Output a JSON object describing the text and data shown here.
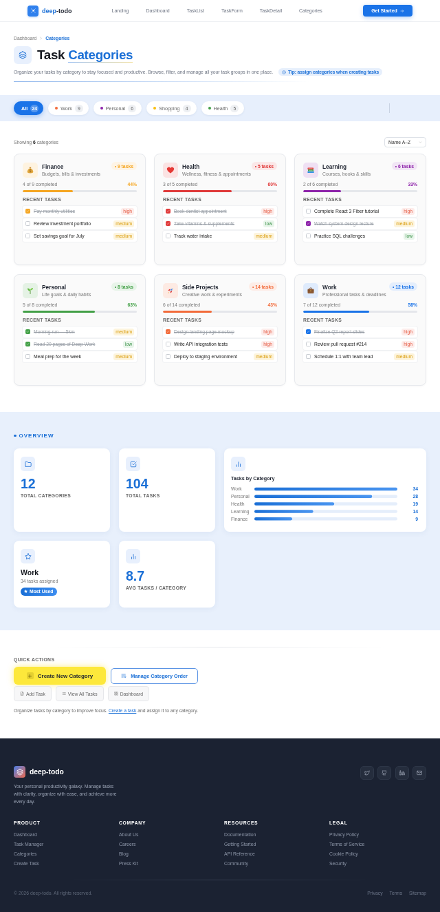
{
  "nav": {
    "brand": {
      "accent": "deep",
      "rest": "-todo"
    },
    "links": [
      "Landing",
      "Dashboard",
      "TaskList",
      "TaskForm",
      "TaskDetail",
      "Categories"
    ],
    "cta": "Get Started"
  },
  "breadcrumb": [
    {
      "label": "Dashboard",
      "current": false
    },
    {
      "label": "Categories",
      "current": true
    }
  ],
  "hero": {
    "title": "Task",
    "title_accent": "Categories",
    "description": "Organize your tasks by category to stay focused and productive. Browse, filter, and manage all your task groups in one place.",
    "tip": "Tip: assign categories when creating tasks"
  },
  "filters": [
    {
      "label": "All",
      "count": "24",
      "selected": true
    },
    {
      "label": "Work",
      "count": "9",
      "selected": false,
      "color": "#f26b3a"
    },
    {
      "label": "Personal",
      "count": "6",
      "selected": false,
      "color": "#8e24aa"
    },
    {
      "label": "Shopping",
      "count": "4",
      "selected": false,
      "color": "#f9bf0f"
    },
    {
      "label": "Health",
      "count": "5",
      "selected": false,
      "color": "#43a047"
    }
  ],
  "listing": {
    "summary": "Showing **6** categories",
    "sort": "Name A–Z"
  },
  "categories": [
    {
      "name": "Finance",
      "description": "Budgets, bills & investments",
      "color": "#f5a623",
      "badge": "• 9 tasks",
      "progress": "4 of 9 completed",
      "percent": "44%",
      "level": 0.44,
      "section_label": "RECENT TASKS",
      "tasks": [
        {
          "title": "Pay monthly utilities",
          "done": true,
          "priority": "high",
          "kind": "high"
        },
        {
          "title": "Review investment portfolio",
          "done": false,
          "priority": "medium",
          "kind": "medium"
        },
        {
          "title": "Set savings goal for July",
          "done": false,
          "priority": "medium",
          "kind": "medium"
        }
      ]
    },
    {
      "name": "Health",
      "description": "Wellness, fitness & appointments",
      "color": "#e03a3a",
      "badge": "• 5 tasks",
      "progress": "3 of 5 completed",
      "percent": "60%",
      "level": 0.6,
      "section_label": "RECENT TASKS",
      "tasks": [
        {
          "title": "Book dentist appointment",
          "done": true,
          "priority": "high",
          "kind": "high"
        },
        {
          "title": "Take vitamins & supplements",
          "done": true,
          "priority": "low",
          "kind": "low"
        },
        {
          "title": "Track water intake",
          "done": false,
          "priority": "medium",
          "kind": "medium"
        }
      ]
    },
    {
      "name": "Learning",
      "description": "Courses, books & skills",
      "color": "#8e24aa",
      "badge": "• 6 tasks",
      "progress": "2 of 6 completed",
      "percent": "33%",
      "level": 0.33,
      "section_label": "RECENT TASKS",
      "tasks": [
        {
          "title": "Complete React 3 Fiber tutorial",
          "done": false,
          "priority": "high",
          "kind": "high"
        },
        {
          "title": "Watch system design lecture",
          "done": true,
          "priority": "medium",
          "kind": "medium"
        },
        {
          "title": "Practice SQL challenges",
          "done": false,
          "priority": "low",
          "kind": "low"
        }
      ]
    },
    {
      "name": "Personal",
      "description": "Life goals & daily habits",
      "color": "#43a047",
      "badge": "• 8 tasks",
      "progress": "5 of 8 completed",
      "percent": "63%",
      "level": 0.63,
      "section_label": "RECENT TASKS",
      "tasks": [
        {
          "title": "Morning run — 5km",
          "done": true,
          "priority": "medium",
          "kind": "medium"
        },
        {
          "title": "Read 20 pages of Deep Work",
          "done": true,
          "priority": "low",
          "kind": "low"
        },
        {
          "title": "Meal prep for the week",
          "done": false,
          "priority": "medium",
          "kind": "medium"
        }
      ]
    },
    {
      "name": "Side Projects",
      "description": "Creative work & experiments",
      "color": "#f26b3a",
      "badge": "• 14 tasks",
      "progress": "6 of 14 completed",
      "percent": "43%",
      "level": 0.43,
      "section_label": "RECENT TASKS",
      "tasks": [
        {
          "title": "Design landing page mockup",
          "done": true,
          "priority": "high",
          "kind": "high"
        },
        {
          "title": "Write API integration tests",
          "done": false,
          "priority": "high",
          "kind": "high"
        },
        {
          "title": "Deploy to staging environment",
          "done": false,
          "priority": "medium",
          "kind": "medium"
        }
      ]
    },
    {
      "name": "Work",
      "description": "Professional tasks & deadlines",
      "color": "#1a73e8",
      "badge": "• 12 tasks",
      "progress": "7 of 12 completed",
      "percent": "58%",
      "level": 0.58,
      "section_label": "RECENT TASKS",
      "tasks": [
        {
          "title": "Finalize Q2 report slides",
          "done": true,
          "priority": "high",
          "kind": "high"
        },
        {
          "title": "Review pull request #214",
          "done": false,
          "priority": "high",
          "kind": "high"
        },
        {
          "title": "Schedule 1:1 with team lead",
          "done": false,
          "priority": "medium",
          "kind": "medium"
        }
      ]
    }
  ],
  "overview": {
    "heading": "OVERVIEW",
    "cards": [
      {
        "kind": "stat",
        "value": "12",
        "label": "TOTAL CATEGORIES"
      },
      {
        "kind": "stat",
        "value": "104",
        "label": "TOTAL TASKS"
      },
      {
        "kind": "chart",
        "chart_data": {
          "type": "bar",
          "orientation": "horizontal",
          "title": "Tasks by Category",
          "categories": [
            "Work",
            "Personal",
            "Health",
            "Learning",
            "Finance"
          ],
          "values": [
            34,
            28,
            19,
            14,
            9
          ],
          "data_labels": true
        }
      },
      {
        "kind": "featured",
        "title": "Work",
        "detail": "34 tasks assigned",
        "badge": "Most Used"
      },
      {
        "kind": "stat",
        "value": "8.7",
        "label": "AVG TASKS / CATEGORY"
      }
    ]
  },
  "quick_actions": {
    "heading": "QUICK ACTIONS",
    "primary": "Create New Category",
    "secondary": "Manage Category Order",
    "links": [
      "Add Task",
      "View All Tasks",
      "Dashboard"
    ],
    "note": {
      "before": "Organize tasks by category to improve focus.",
      "link": "Create a task",
      "after": "and assign it to any category."
    }
  },
  "footer": {
    "brand": "deep-todo",
    "tagline": "Your personal productivity galaxy. Manage tasks with clarity, organize with ease, and achieve more every day.",
    "columns": [
      {
        "title": "PRODUCT",
        "links": [
          "Dashboard",
          "Task Manager",
          "Categories",
          "Create Task"
        ]
      },
      {
        "title": "COMPANY",
        "links": [
          "About Us",
          "Careers",
          "Blog",
          "Press Kit"
        ]
      },
      {
        "title": "RESOURCES",
        "links": [
          "Documentation",
          "Getting Started",
          "API Reference",
          "Community"
        ]
      },
      {
        "title": "LEGAL",
        "links": [
          "Privacy Policy",
          "Terms of Service",
          "Cookie Policy",
          "Security"
        ]
      }
    ],
    "copyright": "© 2026 deep-todo. All rights reserved.",
    "links": [
      "Privacy",
      "Terms",
      "Sitemap"
    ]
  }
}
